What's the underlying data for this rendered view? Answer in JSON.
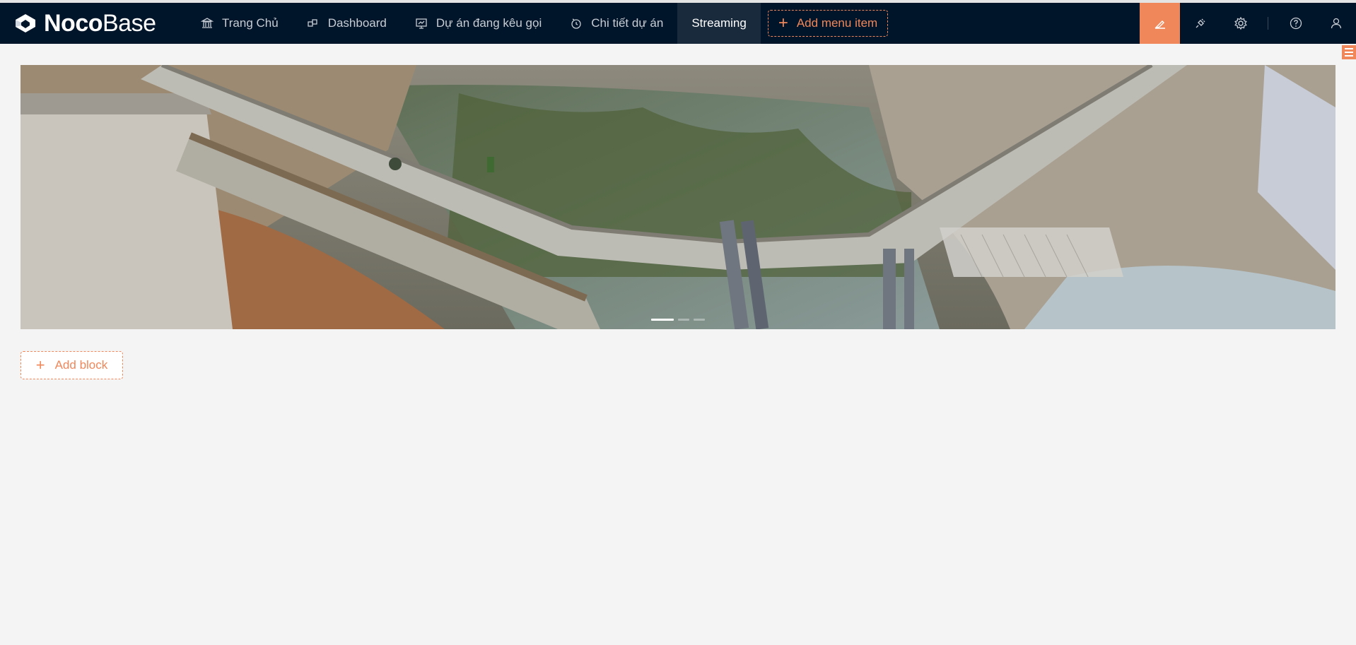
{
  "app": {
    "logo_bold": "Noco",
    "logo_light": "Base"
  },
  "nav": {
    "items": [
      {
        "label": "Trang Chủ",
        "icon": "bank-icon"
      },
      {
        "label": "Dashboard",
        "icon": "block-icon"
      },
      {
        "label": "Dự án đang kêu gọi",
        "icon": "fund-projection-icon"
      },
      {
        "label": "Chi tiết dự án",
        "icon": "clock-icon"
      },
      {
        "label": "Streaming",
        "icon": "",
        "active": true
      }
    ],
    "add_menu_label": "Add menu item"
  },
  "toolbar": {
    "tools": [
      "highlight-icon",
      "plugin-icon",
      "setting-icon",
      "question-icon",
      "user-icon"
    ],
    "accent_color": "#f0875a",
    "nav_bg": "#001529"
  },
  "carousel": {
    "slides": 3,
    "active_slide": 1,
    "image_description_icon": "bridge-photo"
  },
  "page": {
    "add_block_label": "Add block"
  }
}
